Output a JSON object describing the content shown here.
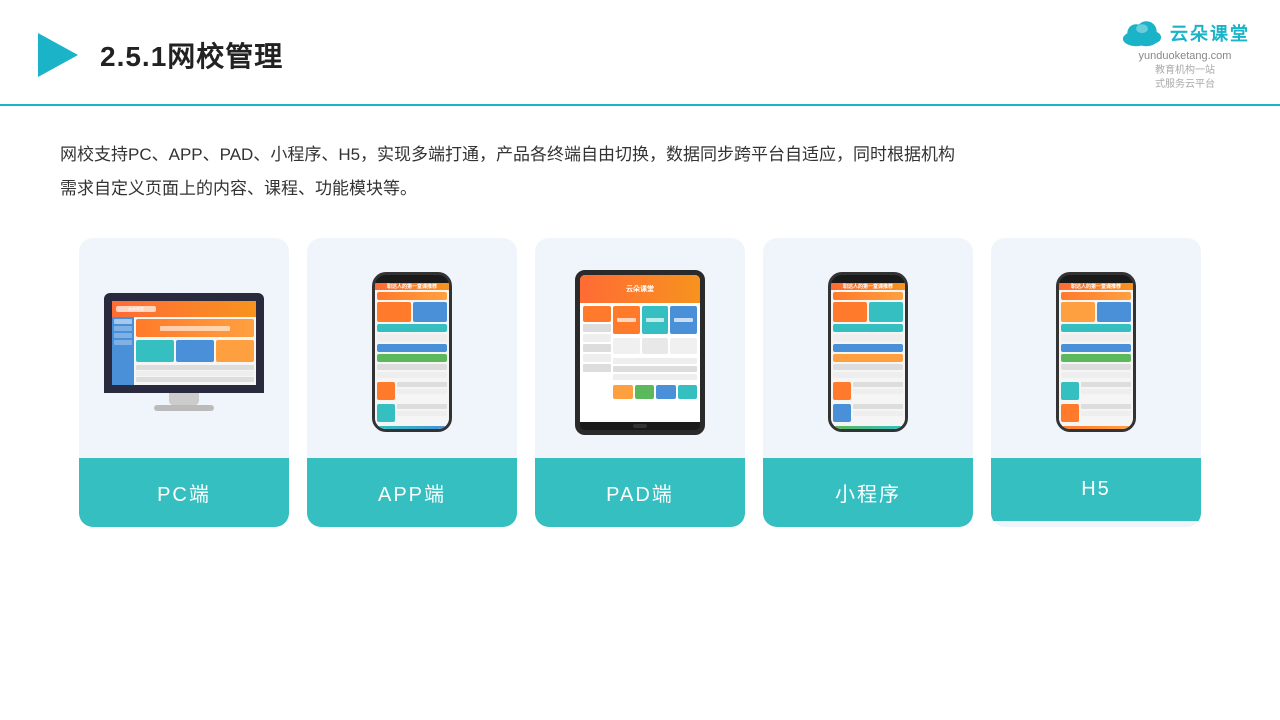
{
  "header": {
    "title": "2.5.1网校管理",
    "logo_main": "云朵课堂",
    "logo_url": "yunduoketang.com",
    "logo_sub": "教育机构一站\n式服务云平台"
  },
  "description": "网校支持PC、APP、PAD、小程序、H5，实现多端打通，产品各终端自由切换，数据同步跨平台自适应，同时根据机构\n需求自定义页面上的内容、课程、功能模块等。",
  "cards": [
    {
      "id": "pc",
      "label": "PC端"
    },
    {
      "id": "app",
      "label": "APP端"
    },
    {
      "id": "pad",
      "label": "PAD端"
    },
    {
      "id": "miniapp",
      "label": "小程序"
    },
    {
      "id": "h5",
      "label": "H5"
    }
  ],
  "colors": {
    "teal": "#35bfc0",
    "accent": "#1ab3c8",
    "bg_card": "#f0f4fb"
  }
}
